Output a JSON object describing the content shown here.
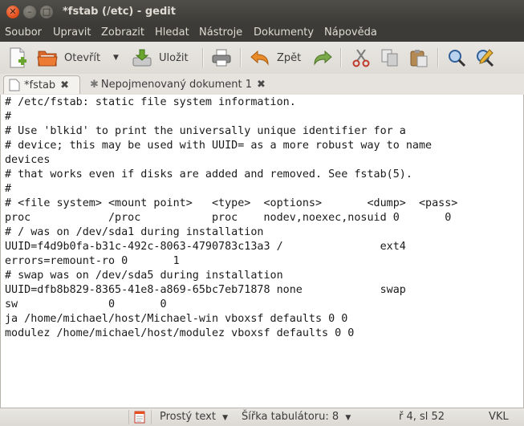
{
  "window": {
    "title": "*fstab (/etc) - gedit"
  },
  "menu": [
    "Soubor",
    "Upravit",
    "Zobrazit",
    "Hledat",
    "Nástroje",
    "Dokumenty",
    "Nápověda"
  ],
  "toolbar": {
    "open_label": "Otevřít",
    "save_label": "Uložit",
    "undo_label": "Zpět"
  },
  "tabs": [
    {
      "label": "*fstab",
      "icon": "document-icon",
      "active": true
    },
    {
      "label": "Nepojmenovaný dokument 1",
      "icon": "new-document-icon",
      "active": false
    }
  ],
  "editor": {
    "lines": [
      "# /etc/fstab: static file system information.",
      "#",
      "# Use 'blkid' to print the universally unique identifier for a",
      "# device; this may be used with UUID= as a more robust way to name",
      "devices",
      "# that works even if disks are added and removed. See fstab(5).",
      "#",
      "# <file system> <mount point>   <type>  <options>       <dump>  <pass>",
      "proc            /proc           proc    nodev,noexec,nosuid 0       0",
      "# / was on /dev/sda1 during installation",
      "UUID=f4d9b0fa-b31c-492c-8063-4790783c13a3 /               ext4",
      "errors=remount-ro 0       1",
      "# swap was on /dev/sda5 during installation",
      "UUID=dfb8b829-8365-41e8-a869-65bc7eb71878 none            swap",
      "sw              0       0",
      "ja /home/michael/host/Michael-win vboxsf defaults 0 0",
      "modulez /home/michael/host/modulez vboxsf defaults 0 0"
    ]
  },
  "status": {
    "language": "Prostý text",
    "tab_width": "Šířka tabulátoru: 8",
    "position": "ř 4, sl 52",
    "mode": "VKL"
  },
  "colors": {
    "titlebar": "#3c3b37",
    "close_button": "#e4511f",
    "editor_bg": "#ffffff"
  }
}
